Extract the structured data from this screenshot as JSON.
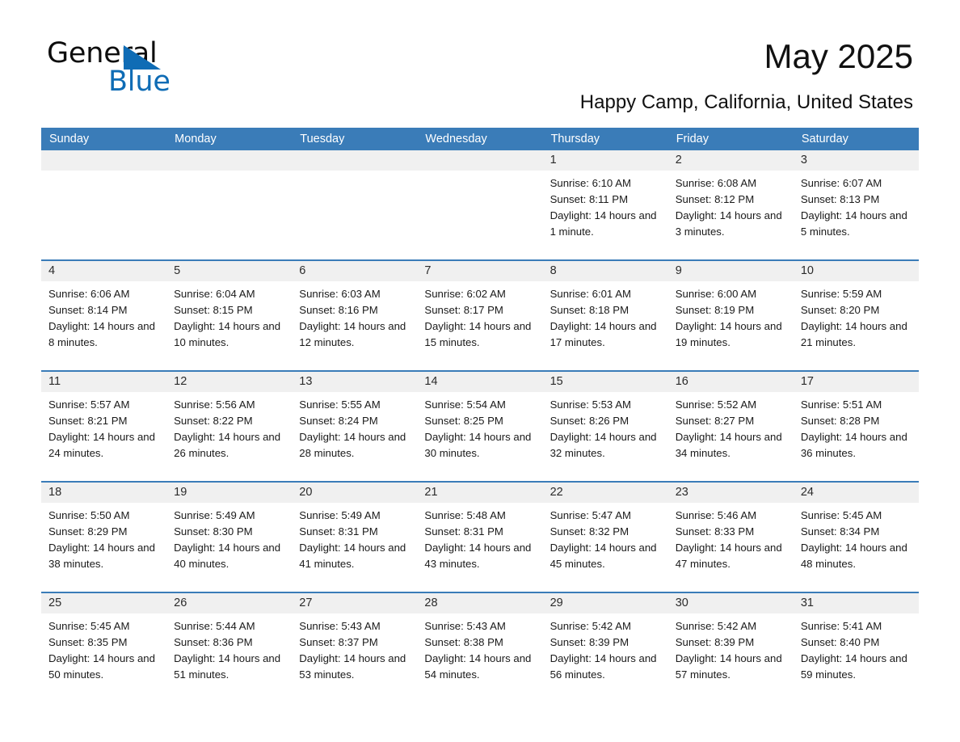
{
  "brand": {
    "name_part1": "General",
    "name_part2": "Blue",
    "triangle_color": "#0f6cb5",
    "text_color": "#0d0d0d"
  },
  "header": {
    "month_title": "May 2025",
    "location": "Happy Camp, California, United States",
    "header_bg": "#3a7cb8",
    "header_text_color": "#ffffff",
    "date_band_bg": "#f0f0f0"
  },
  "weekdays": [
    "Sunday",
    "Monday",
    "Tuesday",
    "Wednesday",
    "Thursday",
    "Friday",
    "Saturday"
  ],
  "weeks": [
    [
      {
        "day": "",
        "sunrise": "",
        "sunset": "",
        "daylight": "",
        "empty": true
      },
      {
        "day": "",
        "sunrise": "",
        "sunset": "",
        "daylight": "",
        "empty": true
      },
      {
        "day": "",
        "sunrise": "",
        "sunset": "",
        "daylight": "",
        "empty": true
      },
      {
        "day": "",
        "sunrise": "",
        "sunset": "",
        "daylight": "",
        "empty": true
      },
      {
        "day": "1",
        "sunrise": "Sunrise: 6:10 AM",
        "sunset": "Sunset: 8:11 PM",
        "daylight": "Daylight: 14 hours and 1 minute.",
        "empty": false
      },
      {
        "day": "2",
        "sunrise": "Sunrise: 6:08 AM",
        "sunset": "Sunset: 8:12 PM",
        "daylight": "Daylight: 14 hours and 3 minutes.",
        "empty": false
      },
      {
        "day": "3",
        "sunrise": "Sunrise: 6:07 AM",
        "sunset": "Sunset: 8:13 PM",
        "daylight": "Daylight: 14 hours and 5 minutes.",
        "empty": false
      }
    ],
    [
      {
        "day": "4",
        "sunrise": "Sunrise: 6:06 AM",
        "sunset": "Sunset: 8:14 PM",
        "daylight": "Daylight: 14 hours and 8 minutes.",
        "empty": false
      },
      {
        "day": "5",
        "sunrise": "Sunrise: 6:04 AM",
        "sunset": "Sunset: 8:15 PM",
        "daylight": "Daylight: 14 hours and 10 minutes.",
        "empty": false
      },
      {
        "day": "6",
        "sunrise": "Sunrise: 6:03 AM",
        "sunset": "Sunset: 8:16 PM",
        "daylight": "Daylight: 14 hours and 12 minutes.",
        "empty": false
      },
      {
        "day": "7",
        "sunrise": "Sunrise: 6:02 AM",
        "sunset": "Sunset: 8:17 PM",
        "daylight": "Daylight: 14 hours and 15 minutes.",
        "empty": false
      },
      {
        "day": "8",
        "sunrise": "Sunrise: 6:01 AM",
        "sunset": "Sunset: 8:18 PM",
        "daylight": "Daylight: 14 hours and 17 minutes.",
        "empty": false
      },
      {
        "day": "9",
        "sunrise": "Sunrise: 6:00 AM",
        "sunset": "Sunset: 8:19 PM",
        "daylight": "Daylight: 14 hours and 19 minutes.",
        "empty": false
      },
      {
        "day": "10",
        "sunrise": "Sunrise: 5:59 AM",
        "sunset": "Sunset: 8:20 PM",
        "daylight": "Daylight: 14 hours and 21 minutes.",
        "empty": false
      }
    ],
    [
      {
        "day": "11",
        "sunrise": "Sunrise: 5:57 AM",
        "sunset": "Sunset: 8:21 PM",
        "daylight": "Daylight: 14 hours and 24 minutes.",
        "empty": false
      },
      {
        "day": "12",
        "sunrise": "Sunrise: 5:56 AM",
        "sunset": "Sunset: 8:22 PM",
        "daylight": "Daylight: 14 hours and 26 minutes.",
        "empty": false
      },
      {
        "day": "13",
        "sunrise": "Sunrise: 5:55 AM",
        "sunset": "Sunset: 8:24 PM",
        "daylight": "Daylight: 14 hours and 28 minutes.",
        "empty": false
      },
      {
        "day": "14",
        "sunrise": "Sunrise: 5:54 AM",
        "sunset": "Sunset: 8:25 PM",
        "daylight": "Daylight: 14 hours and 30 minutes.",
        "empty": false
      },
      {
        "day": "15",
        "sunrise": "Sunrise: 5:53 AM",
        "sunset": "Sunset: 8:26 PM",
        "daylight": "Daylight: 14 hours and 32 minutes.",
        "empty": false
      },
      {
        "day": "16",
        "sunrise": "Sunrise: 5:52 AM",
        "sunset": "Sunset: 8:27 PM",
        "daylight": "Daylight: 14 hours and 34 minutes.",
        "empty": false
      },
      {
        "day": "17",
        "sunrise": "Sunrise: 5:51 AM",
        "sunset": "Sunset: 8:28 PM",
        "daylight": "Daylight: 14 hours and 36 minutes.",
        "empty": false
      }
    ],
    [
      {
        "day": "18",
        "sunrise": "Sunrise: 5:50 AM",
        "sunset": "Sunset: 8:29 PM",
        "daylight": "Daylight: 14 hours and 38 minutes.",
        "empty": false
      },
      {
        "day": "19",
        "sunrise": "Sunrise: 5:49 AM",
        "sunset": "Sunset: 8:30 PM",
        "daylight": "Daylight: 14 hours and 40 minutes.",
        "empty": false
      },
      {
        "day": "20",
        "sunrise": "Sunrise: 5:49 AM",
        "sunset": "Sunset: 8:31 PM",
        "daylight": "Daylight: 14 hours and 41 minutes.",
        "empty": false
      },
      {
        "day": "21",
        "sunrise": "Sunrise: 5:48 AM",
        "sunset": "Sunset: 8:31 PM",
        "daylight": "Daylight: 14 hours and 43 minutes.",
        "empty": false
      },
      {
        "day": "22",
        "sunrise": "Sunrise: 5:47 AM",
        "sunset": "Sunset: 8:32 PM",
        "daylight": "Daylight: 14 hours and 45 minutes.",
        "empty": false
      },
      {
        "day": "23",
        "sunrise": "Sunrise: 5:46 AM",
        "sunset": "Sunset: 8:33 PM",
        "daylight": "Daylight: 14 hours and 47 minutes.",
        "empty": false
      },
      {
        "day": "24",
        "sunrise": "Sunrise: 5:45 AM",
        "sunset": "Sunset: 8:34 PM",
        "daylight": "Daylight: 14 hours and 48 minutes.",
        "empty": false
      }
    ],
    [
      {
        "day": "25",
        "sunrise": "Sunrise: 5:45 AM",
        "sunset": "Sunset: 8:35 PM",
        "daylight": "Daylight: 14 hours and 50 minutes.",
        "empty": false
      },
      {
        "day": "26",
        "sunrise": "Sunrise: 5:44 AM",
        "sunset": "Sunset: 8:36 PM",
        "daylight": "Daylight: 14 hours and 51 minutes.",
        "empty": false
      },
      {
        "day": "27",
        "sunrise": "Sunrise: 5:43 AM",
        "sunset": "Sunset: 8:37 PM",
        "daylight": "Daylight: 14 hours and 53 minutes.",
        "empty": false
      },
      {
        "day": "28",
        "sunrise": "Sunrise: 5:43 AM",
        "sunset": "Sunset: 8:38 PM",
        "daylight": "Daylight: 14 hours and 54 minutes.",
        "empty": false
      },
      {
        "day": "29",
        "sunrise": "Sunrise: 5:42 AM",
        "sunset": "Sunset: 8:39 PM",
        "daylight": "Daylight: 14 hours and 56 minutes.",
        "empty": false
      },
      {
        "day": "30",
        "sunrise": "Sunrise: 5:42 AM",
        "sunset": "Sunset: 8:39 PM",
        "daylight": "Daylight: 14 hours and 57 minutes.",
        "empty": false
      },
      {
        "day": "31",
        "sunrise": "Sunrise: 5:41 AM",
        "sunset": "Sunset: 8:40 PM",
        "daylight": "Daylight: 14 hours and 59 minutes.",
        "empty": false
      }
    ]
  ]
}
